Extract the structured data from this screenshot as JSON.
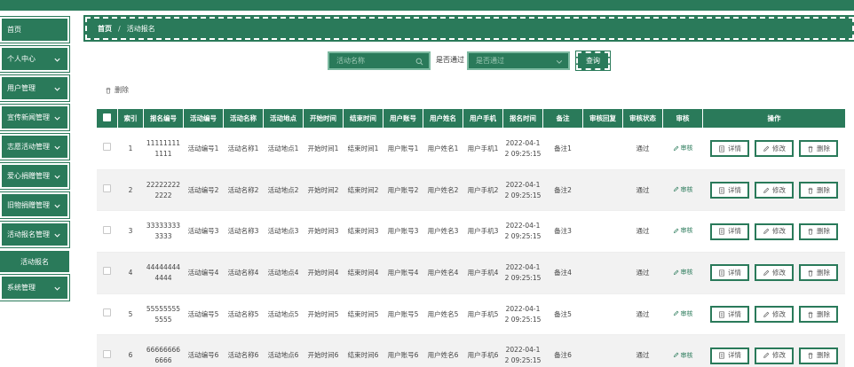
{
  "sidebar": {
    "items": [
      {
        "label": "首页",
        "has_chevron": false
      },
      {
        "label": "个人中心",
        "has_chevron": true
      },
      {
        "label": "用户管理",
        "has_chevron": true
      },
      {
        "label": "宣传新闻管理",
        "has_chevron": true
      },
      {
        "label": "志愿活动管理",
        "has_chevron": true
      },
      {
        "label": "爱心捐赠管理",
        "has_chevron": true
      },
      {
        "label": "旧物捐赠管理",
        "has_chevron": true
      },
      {
        "label": "活动报名管理",
        "has_chevron": true
      },
      {
        "label": "系统管理",
        "has_chevron": true
      }
    ],
    "active_sub": "活动报名"
  },
  "breadcrumb": {
    "home": "首页",
    "separator": "/",
    "current": "活动报名"
  },
  "search": {
    "name_placeholder": "活动名称",
    "filter_label": "是否通过",
    "filter_placeholder": "是否通过",
    "query_label": "查询"
  },
  "toolbar": {
    "delete_label": "删除"
  },
  "table": {
    "columns": [
      "索引",
      "报名编号",
      "活动编号",
      "活动名称",
      "活动地点",
      "开始时间",
      "结束时间",
      "用户账号",
      "用户姓名",
      "用户手机",
      "报名时间",
      "备注",
      "审核回复",
      "审核状态",
      "审核",
      "操作"
    ],
    "rows": [
      {
        "index": "1",
        "reg_no": "111111111111",
        "act_no": "活动编号1",
        "act_name": "活动名称1",
        "place": "活动地点1",
        "start": "开始时间1",
        "end": "结束时间1",
        "account": "用户账号1",
        "uname": "用户姓名1",
        "phone": "用户手机1",
        "reg_time": "2022-04-12 09:25:15",
        "note": "备注1",
        "reply": "",
        "status": "通过"
      },
      {
        "index": "2",
        "reg_no": "222222222222",
        "act_no": "活动编号2",
        "act_name": "活动名称2",
        "place": "活动地点2",
        "start": "开始时间2",
        "end": "结束时间2",
        "account": "用户账号2",
        "uname": "用户姓名2",
        "phone": "用户手机2",
        "reg_time": "2022-04-12 09:25:15",
        "note": "备注2",
        "reply": "",
        "status": "通过"
      },
      {
        "index": "3",
        "reg_no": "333333333333",
        "act_no": "活动编号3",
        "act_name": "活动名称3",
        "place": "活动地点3",
        "start": "开始时间3",
        "end": "结束时间3",
        "account": "用户账号3",
        "uname": "用户姓名3",
        "phone": "用户手机3",
        "reg_time": "2022-04-12 09:25:15",
        "note": "备注3",
        "reply": "",
        "status": "通过"
      },
      {
        "index": "4",
        "reg_no": "444444444444",
        "act_no": "活动编号4",
        "act_name": "活动名称4",
        "place": "活动地点4",
        "start": "开始时间4",
        "end": "结束时间4",
        "account": "用户账号4",
        "uname": "用户姓名4",
        "phone": "用户手机4",
        "reg_time": "2022-04-12 09:25:15",
        "note": "备注4",
        "reply": "",
        "status": "通过"
      },
      {
        "index": "5",
        "reg_no": "555555555555",
        "act_no": "活动编号5",
        "act_name": "活动名称5",
        "place": "活动地点5",
        "start": "开始时间5",
        "end": "结束时间5",
        "account": "用户账号5",
        "uname": "用户姓名5",
        "phone": "用户手机5",
        "reg_time": "2022-04-12 09:25:15",
        "note": "备注5",
        "reply": "",
        "status": "通过"
      },
      {
        "index": "6",
        "reg_no": "666666666666",
        "act_no": "活动编号6",
        "act_name": "活动名称6",
        "place": "活动地点6",
        "start": "开始时间6",
        "end": "结束时间6",
        "account": "用户账号6",
        "uname": "用户姓名6",
        "phone": "用户手机6",
        "reg_time": "2022-04-12 09:25:15",
        "note": "备注6",
        "reply": "",
        "status": "通过"
      }
    ],
    "audit_label": "审核",
    "actions": {
      "detail": "详情",
      "edit": "修改",
      "delete": "删除"
    }
  },
  "colors": {
    "brand": "#2a7a5a",
    "brand_light": "#7cb9a0",
    "row_alt": "#f2f2f2"
  }
}
